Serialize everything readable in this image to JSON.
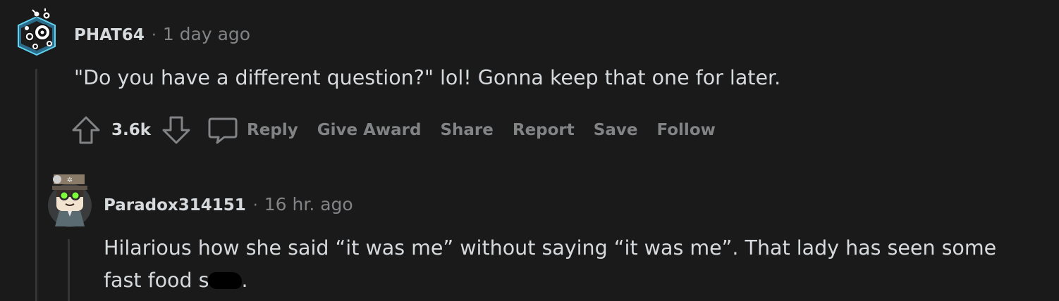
{
  "comments": [
    {
      "author": "PHAT64",
      "separator": "·",
      "time": "1 day ago",
      "body": "\"Do you have a different question?\" lol! Gonna keep that one for later.",
      "score": "3.6k",
      "actions": {
        "reply": "Reply",
        "give_award": "Give Award",
        "share": "Share",
        "report": "Report",
        "save": "Save",
        "follow": "Follow"
      },
      "avatar_icon": "eye-robot-avatar-icon"
    },
    {
      "author": "Paradox314151",
      "separator": "·",
      "time": "16 hr. ago",
      "body_line1": "Hilarious how she said “it was me” without saying “it was me”. That lady has seen some",
      "body_line2_prefix": "fast food s",
      "body_line2_suffix": ".",
      "avatar_icon": "goggles-character-avatar-icon"
    }
  ],
  "colors": {
    "background": "#1a1a1b",
    "text": "#d7dadc",
    "muted": "#818384",
    "thread_line": "#343536"
  }
}
